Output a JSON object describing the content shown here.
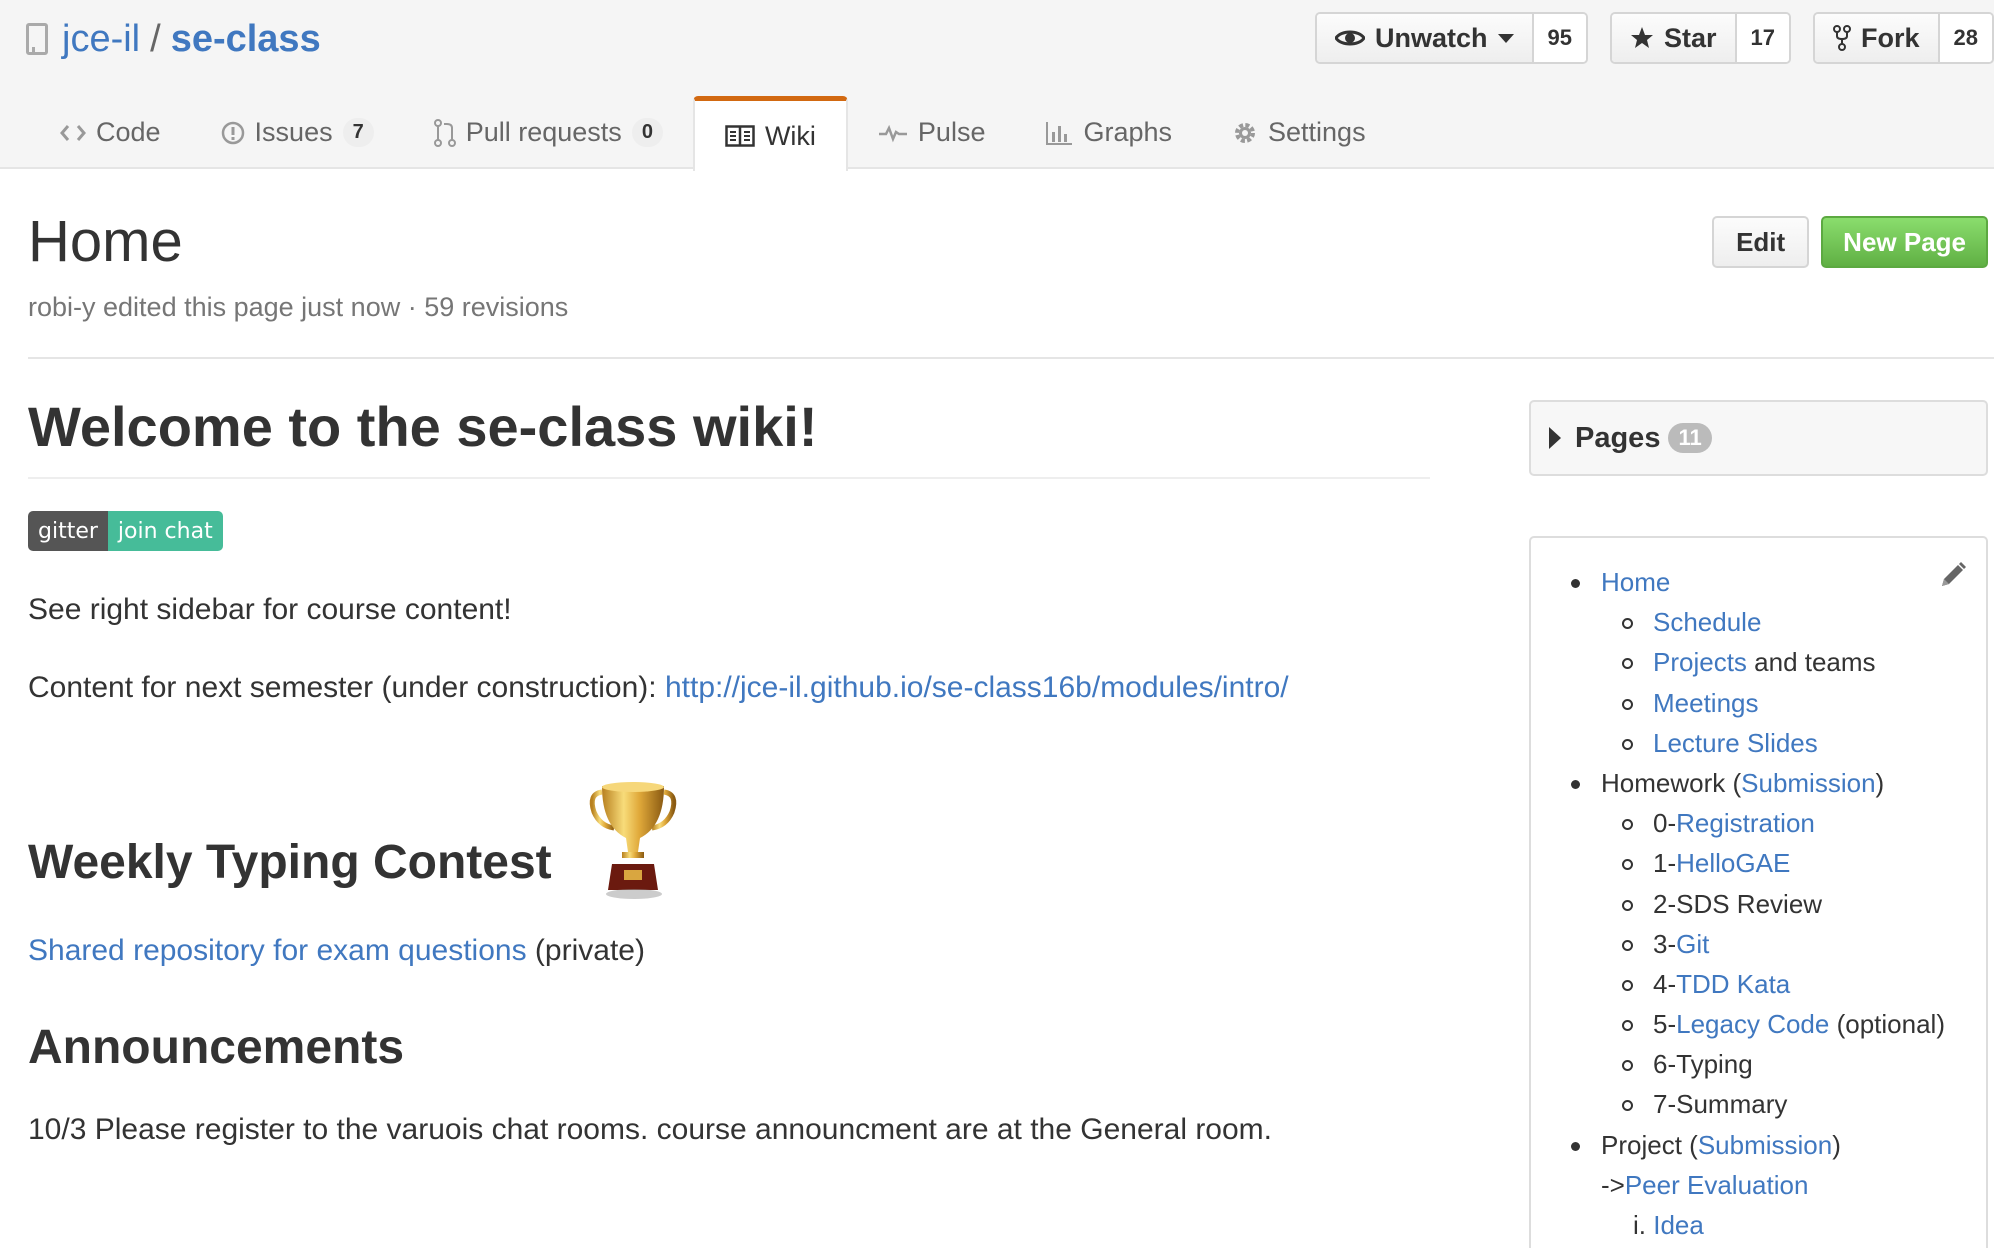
{
  "repo": {
    "owner": "jce-il",
    "separator": "/",
    "name": "se-class"
  },
  "actions": {
    "watch": {
      "label": "Unwatch",
      "count": "95"
    },
    "star": {
      "label": "Star",
      "count": "17"
    },
    "fork": {
      "label": "Fork",
      "count": "28"
    }
  },
  "tabs": [
    {
      "label": "Code",
      "icon": "code-icon"
    },
    {
      "label": "Issues",
      "count": "7",
      "icon": "issue-icon"
    },
    {
      "label": "Pull requests",
      "count": "0",
      "icon": "pull-request-icon"
    },
    {
      "label": "Wiki",
      "icon": "book-icon",
      "selected": true
    },
    {
      "label": "Pulse",
      "icon": "pulse-icon"
    },
    {
      "label": "Graphs",
      "icon": "graph-icon"
    },
    {
      "label": "Settings",
      "icon": "gear-icon"
    }
  ],
  "wiki": {
    "title": "Home",
    "meta": "robi-y edited this page just now · 59 revisions",
    "edit_label": "Edit",
    "new_page_label": "New Page"
  },
  "content": {
    "heading": "Welcome to the se-class wiki!",
    "badge_left": "gitter",
    "badge_right": "join chat",
    "sidebar_note": "See right sidebar for course content!",
    "next_semester_text": "Content for next semester (under construction): ",
    "next_semester_link": "http://jce-il.github.io/se-class16b/modules/intro/",
    "typing_heading": "Weekly Typing Contest",
    "shared_repo_link": "Shared repository for exam questions",
    "shared_repo_suffix": " (private)",
    "announcements_heading": "Announcements",
    "announcement": "10/3 Please register to the varuois chat rooms. course announcment are at the General room."
  },
  "sidebar": {
    "pages_label": "Pages",
    "pages_count": "11",
    "items": [
      {
        "level": 1,
        "parts": [
          {
            "t": "Home",
            "link": true
          }
        ]
      },
      {
        "level": 2,
        "parts": [
          {
            "t": "Schedule",
            "link": true
          }
        ]
      },
      {
        "level": 2,
        "parts": [
          {
            "t": "Projects",
            "link": true
          },
          {
            "t": " and teams"
          }
        ]
      },
      {
        "level": 2,
        "parts": [
          {
            "t": "Meetings",
            "link": true
          }
        ]
      },
      {
        "level": 2,
        "parts": [
          {
            "t": "Lecture Slides",
            "link": true
          }
        ]
      },
      {
        "level": 1,
        "parts": [
          {
            "t": "Homework ("
          },
          {
            "t": "Submission",
            "link": true
          },
          {
            "t": ")"
          }
        ]
      },
      {
        "level": 2,
        "parts": [
          {
            "t": "0-"
          },
          {
            "t": "Registration",
            "link": true
          }
        ]
      },
      {
        "level": 2,
        "parts": [
          {
            "t": "1-"
          },
          {
            "t": "HelloGAE",
            "link": true
          }
        ]
      },
      {
        "level": 2,
        "parts": [
          {
            "t": "2-SDS Review"
          }
        ]
      },
      {
        "level": 2,
        "parts": [
          {
            "t": "3-"
          },
          {
            "t": "Git",
            "link": true
          }
        ]
      },
      {
        "level": 2,
        "parts": [
          {
            "t": "4-"
          },
          {
            "t": "TDD Kata",
            "link": true
          }
        ]
      },
      {
        "level": 2,
        "parts": [
          {
            "t": "5-"
          },
          {
            "t": "Legacy Code",
            "link": true
          },
          {
            "t": " (optional)"
          }
        ]
      },
      {
        "level": 2,
        "parts": [
          {
            "t": "6-Typing"
          }
        ]
      },
      {
        "level": 2,
        "parts": [
          {
            "t": "7-Summary"
          }
        ]
      },
      {
        "level": 1,
        "parts": [
          {
            "t": "Project ("
          },
          {
            "t": "Submission",
            "link": true
          },
          {
            "t": ")"
          }
        ]
      },
      {
        "level": 0,
        "parts": [
          {
            "t": "->"
          },
          {
            "t": "Peer Evaluation",
            "link": true
          }
        ]
      },
      {
        "level": 3,
        "parts": [
          {
            "t": "i. "
          },
          {
            "t": "Idea",
            "link": true
          }
        ]
      }
    ]
  }
}
